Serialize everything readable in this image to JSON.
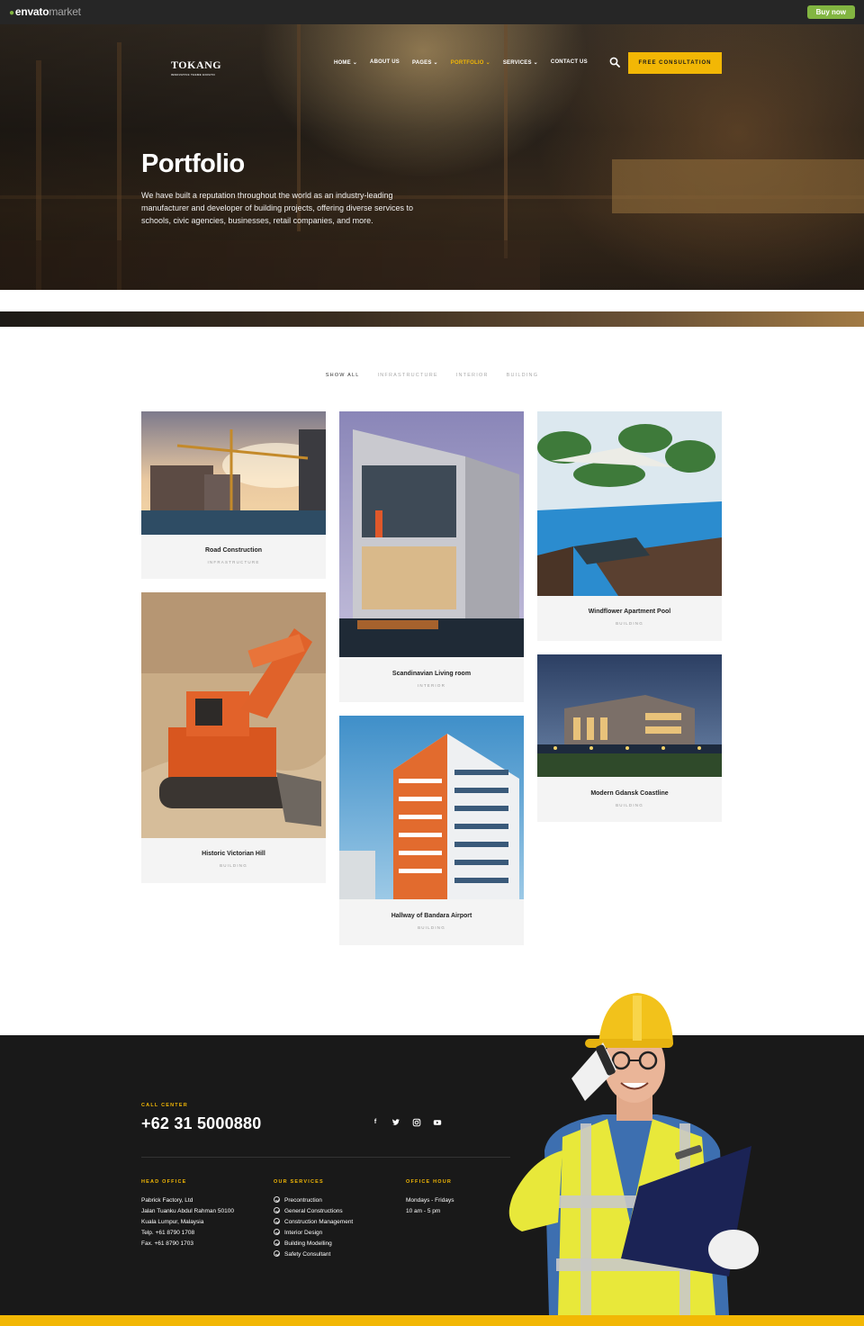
{
  "envato": {
    "logo_main": "envato",
    "logo_market": "market",
    "buy_label": "Buy now"
  },
  "header": {
    "brand": "TOKANG",
    "brand_tagline": "INNOVATIVE THEME ENVATO",
    "nav": [
      {
        "label": "HOME",
        "has_dropdown": true,
        "active": false
      },
      {
        "label": "ABOUT US",
        "has_dropdown": false,
        "active": false
      },
      {
        "label": "PAGES",
        "has_dropdown": true,
        "active": false
      },
      {
        "label": "PORTFOLIO",
        "has_dropdown": true,
        "active": true
      },
      {
        "label": "SERVICES",
        "has_dropdown": true,
        "active": false
      },
      {
        "label": "CONTACT US",
        "has_dropdown": false,
        "active": false
      }
    ],
    "cta_label": "FREE CONSULTATION",
    "search_icon": "search-icon"
  },
  "hero": {
    "title": "Portfolio",
    "description": "We have built a reputation throughout the world as an industry-leading manufacturer and developer of building projects, offering diverse services to schools, civic agencies, businesses, retail companies, and more."
  },
  "filters": [
    {
      "label": "SHOW ALL",
      "active": true
    },
    {
      "label": "INFRASTRUCTURE",
      "active": false
    },
    {
      "label": "INTERIOR",
      "active": false
    },
    {
      "label": "BUILDING",
      "active": false
    }
  ],
  "projects": [
    {
      "title": "Road Construction",
      "category": "INFRASTRUCTURE"
    },
    {
      "title": "Historic Victorian Hill",
      "category": "BUILDING"
    },
    {
      "title": "Scandinavian Living room",
      "category": "INTERIOR"
    },
    {
      "title": "Hallway of Bandara Airport",
      "category": "BUILDING"
    },
    {
      "title": "Windflower Apartment Pool",
      "category": "BUILDING"
    },
    {
      "title": "Modern Gdansk Coastline",
      "category": "BUILDING"
    }
  ],
  "footer": {
    "call_center_label": "CALL CENTER",
    "phone": "+62 31 5000880",
    "socials": [
      "facebook-icon",
      "twitter-icon",
      "instagram-icon",
      "youtube-icon"
    ],
    "head_office_label": "HEAD OFFICE",
    "head_office_lines": [
      "Pabrick Factory, Ltd",
      "Jalan Tuanku Abdul Rahman 50100",
      "Kuala Lumpur, Malaysia",
      "Telp. +61 8790 1708",
      "Fax. +61 8790 1703"
    ],
    "services_label": "OUR SERVICES",
    "services": [
      "Precontruction",
      "General Constructions",
      "Construction Management",
      "Interior Design",
      "Building Modelling",
      "Safety Consultant"
    ],
    "office_hour_label": "OFFICE HOUR",
    "office_hours": [
      "Mondays - Fridays",
      "10 am - 5 pm"
    ]
  },
  "colors": {
    "accent": "#f2b705",
    "footer_bg": "#191919",
    "envato_green": "#82b541"
  }
}
